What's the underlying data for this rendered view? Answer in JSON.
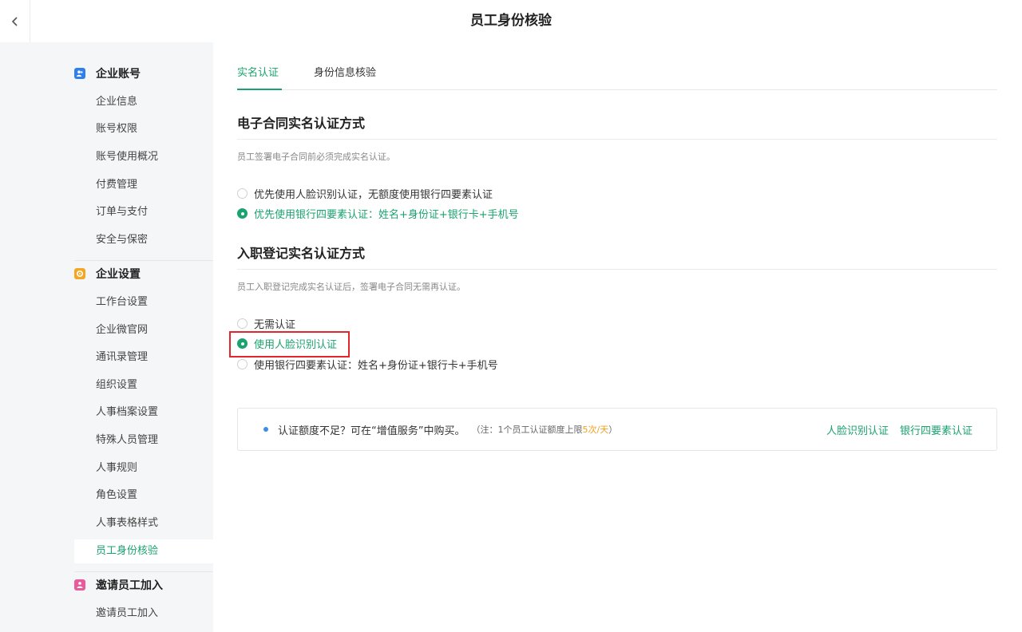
{
  "header": {
    "title": "员工身份核验"
  },
  "sidebar": {
    "groups": [
      {
        "title": "企业账号",
        "color": "#2f80ed",
        "items": [
          "企业信息",
          "账号权限",
          "账号使用概况",
          "付费管理",
          "订单与支付",
          "安全与保密"
        ]
      },
      {
        "title": "企业设置",
        "color": "#f5a623",
        "items": [
          "工作台设置",
          "企业微官网",
          "通讯录管理",
          "组织设置",
          "人事档案设置",
          "特殊人员管理",
          "人事规则",
          "角色设置",
          "人事表格样式",
          "员工身份核验"
        ]
      },
      {
        "title": "邀请员工加入",
        "color": "#e85a9b",
        "items": [
          "邀请员工加入"
        ]
      }
    ]
  },
  "tabs": [
    {
      "label": "实名认证",
      "active": true
    },
    {
      "label": "身份信息核验",
      "active": false
    }
  ],
  "section1": {
    "title": "电子合同实名认证方式",
    "desc": "员工签署电子合同前必须完成实名认证。",
    "options": [
      {
        "label": "优先使用人脸识别认证，无额度使用银行四要素认证",
        "checked": false
      },
      {
        "label": "优先使用银行四要素认证：姓名+身份证+银行卡+手机号",
        "checked": true
      }
    ]
  },
  "section2": {
    "title": "入职登记实名认证方式",
    "desc": "员工入职登记完成实名认证后，签署电子合同无需再认证。",
    "options": [
      {
        "label": "无需认证",
        "checked": false
      },
      {
        "label": "使用人脸识别认证",
        "checked": true
      },
      {
        "label": "使用银行四要素认证：姓名+身份证+银行卡+手机号",
        "checked": false
      }
    ]
  },
  "notice": {
    "text": "认证额度不足？可在“增值服务”中购买。",
    "note_prefix": "（注：1个员工认证额度上限",
    "note_highlight": "5次/天",
    "note_suffix": "）",
    "links": [
      "人脸识别认证",
      "银行四要素认证"
    ]
  },
  "colors": {
    "accent": "#1aa36f",
    "highlight_border": "#e3262b"
  }
}
